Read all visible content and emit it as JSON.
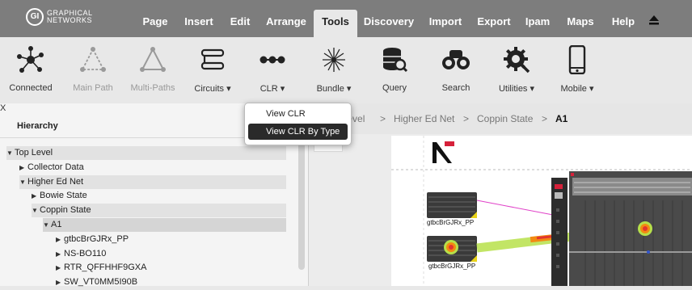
{
  "brand": {
    "logo_mark": "GI",
    "line1": "GRAPHICAL",
    "line2": "NETWORKS"
  },
  "menu": {
    "items": [
      {
        "label": "Page"
      },
      {
        "label": "Insert"
      },
      {
        "label": "Edit"
      },
      {
        "label": "Arrange"
      },
      {
        "label": "Tools"
      },
      {
        "label": "Discovery"
      },
      {
        "label": "Import"
      },
      {
        "label": "Export"
      },
      {
        "label": "Ipam"
      },
      {
        "label": "Maps"
      },
      {
        "label": "Help"
      }
    ],
    "active": "Tools",
    "eject_icon": "eject-icon"
  },
  "toolbar": {
    "tools": [
      {
        "label": "Connected",
        "icon": "connected-icon",
        "enabled": true
      },
      {
        "label": "Main Path",
        "icon": "main-path-icon",
        "enabled": false
      },
      {
        "label": "Multi-Paths",
        "icon": "multi-paths-icon",
        "enabled": false
      },
      {
        "label": "Circuits",
        "icon": "circuits-icon",
        "enabled": true,
        "dropdown": true
      },
      {
        "label": "CLR",
        "icon": "clr-icon",
        "enabled": true,
        "dropdown": true
      },
      {
        "label": "Bundle",
        "icon": "bundle-icon",
        "enabled": true,
        "dropdown": true
      },
      {
        "label": "Query",
        "icon": "database-search-icon",
        "enabled": true
      },
      {
        "label": "Search",
        "icon": "binoculars-icon",
        "enabled": true
      },
      {
        "label": "Utilities",
        "icon": "gear-wrench-icon",
        "enabled": true,
        "dropdown": true
      },
      {
        "label": "Mobile",
        "icon": "mobile-phone-icon",
        "enabled": true,
        "dropdown": true
      }
    ]
  },
  "clr_dropdown": {
    "items": [
      {
        "label": "View CLR",
        "active": false
      },
      {
        "label": "View CLR By Type",
        "active": true
      }
    ]
  },
  "hierarchy": {
    "close_label": "X",
    "title": "Hierarchy",
    "rows": [
      {
        "label": "Top Level",
        "expanded": true
      },
      {
        "label": "Collector Data",
        "expanded": false
      },
      {
        "label": "Higher Ed Net",
        "expanded": true
      },
      {
        "label": "Bowie State",
        "expanded": false
      },
      {
        "label": "Coppin State",
        "expanded": true
      },
      {
        "label": "A1",
        "expanded": true
      },
      {
        "label": "gtbcBrGJRx_PP",
        "expanded": false
      },
      {
        "label": "NS-BO110",
        "expanded": false
      },
      {
        "label": "RTR_QFFHHF9GXA",
        "expanded": false
      },
      {
        "label": "SW_VT0MM5I90B",
        "expanded": false
      }
    ]
  },
  "breadcrumb": {
    "items": [
      "Top Level",
      "Higher Ed Net",
      "Coppin State",
      "A1"
    ],
    "separator": ">"
  },
  "canvas": {
    "devices": [
      {
        "label": "gtbcBrGJRx_PP"
      },
      {
        "label": "gtbcBrGJRx_PP"
      }
    ],
    "colors": {
      "accent_red": "#d6213a",
      "link_green": "#b7e04a",
      "status_red": "#e2362f",
      "status_orange": "#f28a12",
      "link_magenta": "#e041c8"
    }
  }
}
